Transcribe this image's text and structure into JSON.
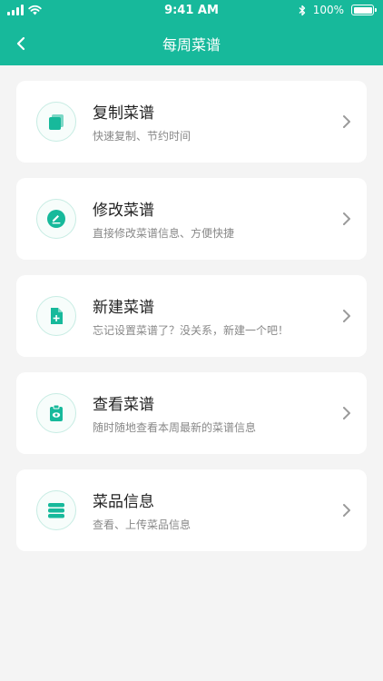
{
  "status": {
    "time": "9:41 AM",
    "battery": "100%",
    "battery_level": 1.0
  },
  "nav": {
    "title": "每周菜谱",
    "back_icon": "chevron-left-icon"
  },
  "colors": {
    "accent": "#17b99b",
    "icon_bg": "#f7fdfb",
    "background": "#f4f4f4"
  },
  "items": [
    {
      "title": "复制菜谱",
      "subtitle": "快速复制、节约时间",
      "icon": "copy-icon"
    },
    {
      "title": "修改菜谱",
      "subtitle": "直接修改菜谱信息、方便快捷",
      "icon": "edit-icon"
    },
    {
      "title": "新建菜谱",
      "subtitle": "忘记设置菜谱了？没关系，新建一个吧！",
      "icon": "new-document-icon"
    },
    {
      "title": "查看菜谱",
      "subtitle": "随时随地查看本周最新的菜谱信息",
      "icon": "view-icon"
    },
    {
      "title": "菜品信息",
      "subtitle": "查看、上传菜品信息",
      "icon": "stack-icon"
    }
  ]
}
